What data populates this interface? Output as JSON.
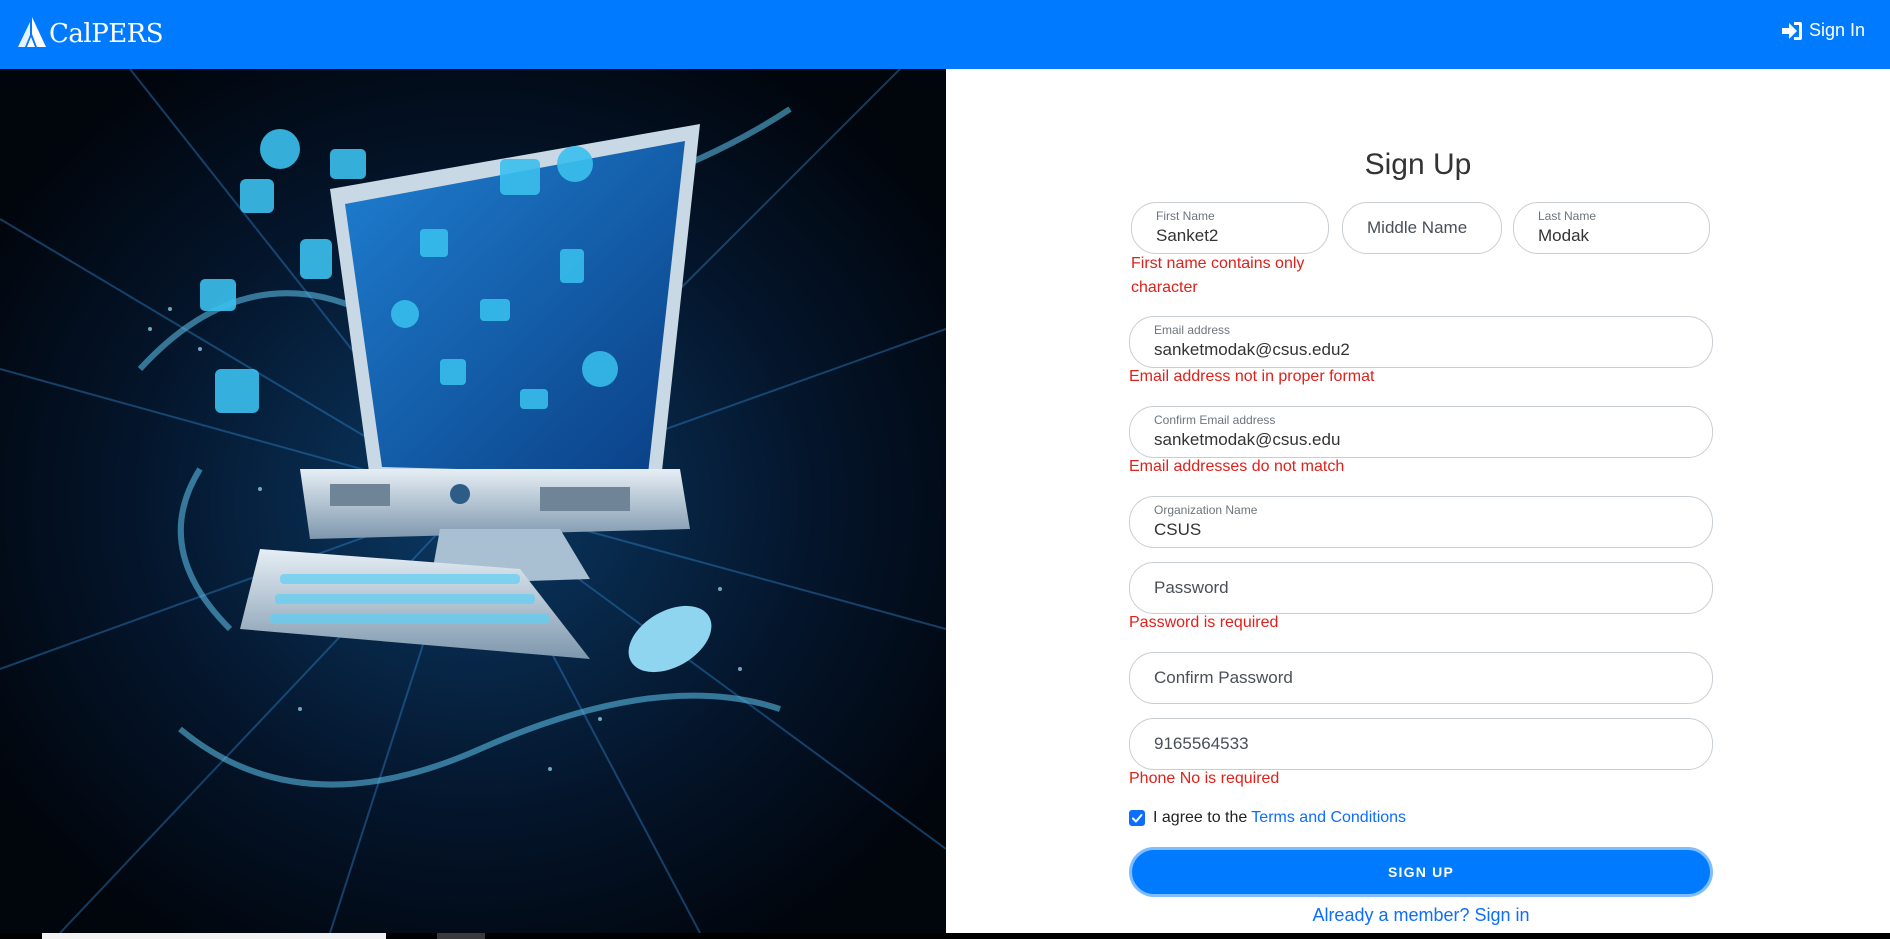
{
  "nav": {
    "brand": "CalPERS",
    "signin_label": "Sign In"
  },
  "form": {
    "title": "Sign Up",
    "first_name": {
      "label": "First Name",
      "value": "Sanket2"
    },
    "middle_name": {
      "placeholder": "Middle Name"
    },
    "last_name": {
      "label": "Last Name",
      "value": "Modak"
    },
    "first_name_error": "First name contains only character",
    "email": {
      "label": "Email address",
      "value": "sanketmodak@csus.edu2"
    },
    "email_error": "Email address not in proper format",
    "confirm_email": {
      "label": "Confirm Email address",
      "value": "sanketmodak@csus.edu"
    },
    "confirm_email_error": "Email addresses do not match",
    "organization": {
      "label": "Organization Name",
      "value": "CSUS"
    },
    "password": {
      "placeholder": "Password"
    },
    "password_error": "Password is required",
    "confirm_password": {
      "placeholder": "Confirm Password"
    },
    "phone": {
      "value": "9165564533"
    },
    "phone_error": "Phone No is required",
    "agree_text": "I agree to the",
    "terms_link": "Terms and Conditions",
    "submit_label": "SIGN UP",
    "member_link": "Already a member? Sign in"
  },
  "colors": {
    "primary": "#007bff",
    "error": "#e0201b",
    "link": "#0d6efd"
  }
}
